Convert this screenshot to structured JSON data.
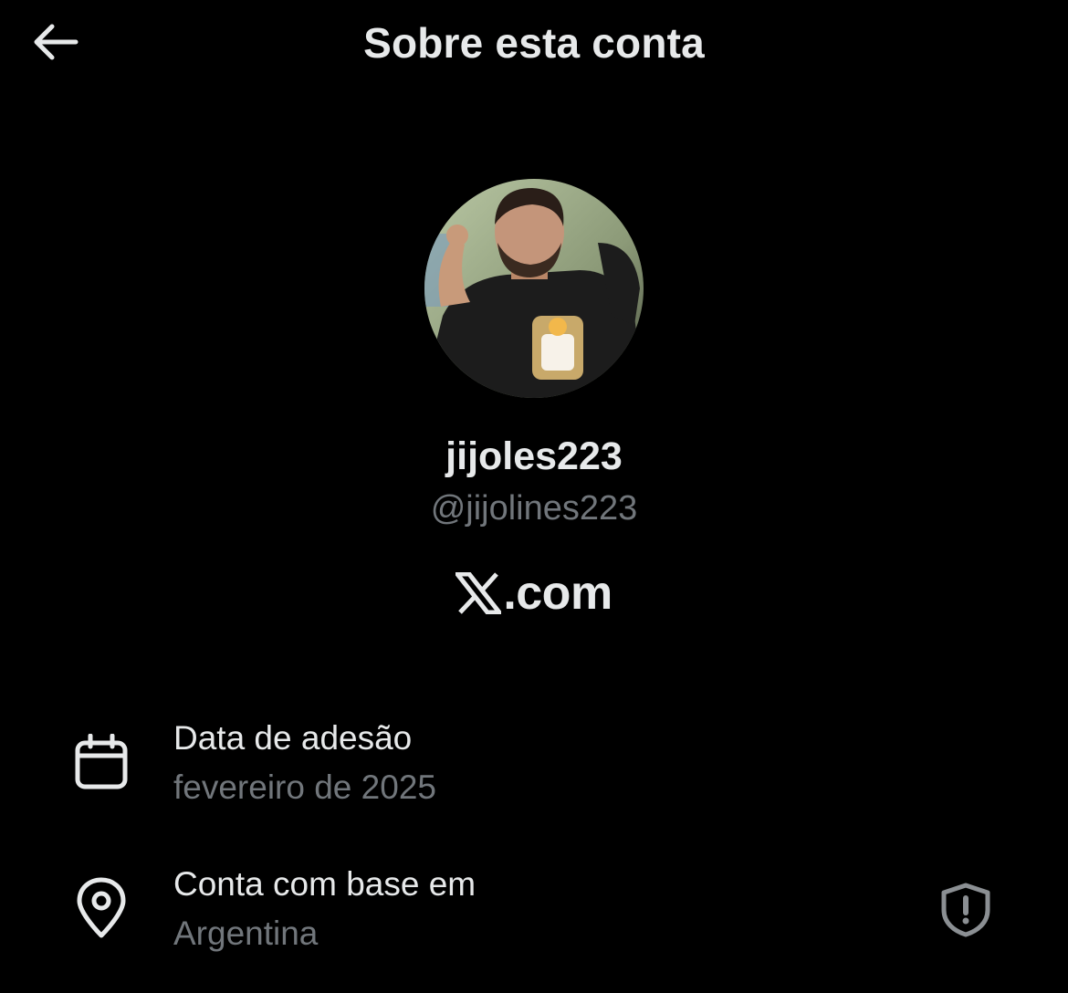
{
  "header": {
    "title": "Sobre esta conta",
    "back_icon": "arrow-left-icon"
  },
  "profile": {
    "display_name": "jijoles223",
    "handle": "@jijolines223",
    "site_label": ".com",
    "site_logo_icon": "x-logo-icon"
  },
  "details": [
    {
      "icon": "calendar-icon",
      "title": "Data de adesão",
      "value": "fevereiro de 2025"
    },
    {
      "icon": "location-pin-icon",
      "title": "Conta com base em",
      "value": "Argentina",
      "trailing_icon": "shield-alert-icon"
    }
  ],
  "colors": {
    "background": "#000000",
    "primary_text": "#e7e9ea",
    "secondary_text": "#71767b"
  }
}
